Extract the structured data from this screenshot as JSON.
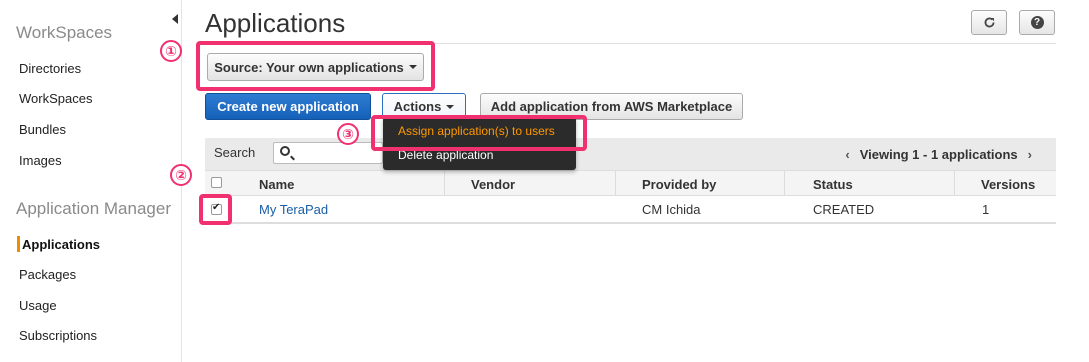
{
  "sidebar": {
    "sections": [
      {
        "heading": "WorkSpaces",
        "items": [
          "Directories",
          "WorkSpaces",
          "Bundles",
          "Images"
        ]
      },
      {
        "heading": "Application Manager",
        "items": [
          "Applications",
          "Packages",
          "Usage",
          "Subscriptions"
        ]
      }
    ],
    "active_item": "Applications"
  },
  "page": {
    "title": "Applications",
    "refresh_icon": "refresh-icon",
    "help_icon": "?"
  },
  "source_button": "Source: Your own applications",
  "buttons": {
    "create": "Create new application",
    "actions": "Actions",
    "marketplace": "Add application from AWS Marketplace"
  },
  "actions_menu": {
    "items": [
      "Assign application(s) to users",
      "Delete application"
    ],
    "highlighted": "Assign application(s) to users"
  },
  "annotations": [
    "①",
    "②",
    "③"
  ],
  "table": {
    "search_label": "Search",
    "search_value": "",
    "pager_text": "Viewing 1 - 1 applications",
    "columns": [
      "Name",
      "Vendor",
      "Provided by",
      "Status",
      "Versions"
    ],
    "rows": [
      {
        "checked": true,
        "name": "My TeraPad",
        "vendor": "",
        "provided_by": "CM Ichida",
        "status": "CREATED",
        "versions": "1"
      }
    ]
  },
  "colors": {
    "highlight": "#f0306f",
    "primary": "#1e6dc8",
    "accent": "#ff9900",
    "active_bar": "#f08c00"
  }
}
